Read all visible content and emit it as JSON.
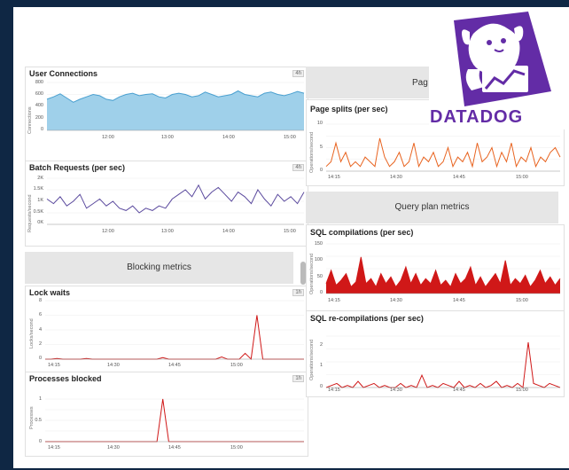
{
  "brand": {
    "name": "DATADOG"
  },
  "panels": {
    "user_connections": {
      "title": "User Connections",
      "badge": "4h",
      "ylabel": "Connections",
      "yticks": [
        "800",
        "600",
        "400",
        "200",
        "0"
      ],
      "xticks": [
        "12:00",
        "13:00",
        "14:00",
        "15:00"
      ]
    },
    "batch_requests": {
      "title": "Batch Requests (per sec)",
      "badge": "4h",
      "ylabel": "Requests/second",
      "yticks": [
        "2K",
        "1.5K",
        "1K",
        "0.5K",
        "0K"
      ],
      "xticks": [
        "12:00",
        "13:00",
        "14:00",
        "15:00"
      ]
    },
    "lock_waits": {
      "title": "Lock waits",
      "badge": "1h",
      "ylabel": "Locks/second",
      "yticks": [
        "8",
        "6",
        "4",
        "2",
        "0"
      ],
      "xticks": [
        "14:15",
        "14:30",
        "14:45",
        "15:00"
      ]
    },
    "processes_blocked": {
      "title": "Processes blocked",
      "badge": "1h",
      "ylabel": "Processes",
      "yticks": [
        "1",
        "0.5",
        "0"
      ],
      "xticks": [
        "14:15",
        "14:30",
        "14:45",
        "15:00"
      ]
    },
    "page_splits": {
      "title": "Page splits (per sec)",
      "ylabel": "Operations/second",
      "yticks": [
        "10",
        "5",
        "0"
      ],
      "xticks": [
        "14:15",
        "14:30",
        "14:45",
        "15:00"
      ]
    },
    "sql_compilations": {
      "title": "SQL compilations (per sec)",
      "ylabel": "Operations/second",
      "yticks": [
        "150",
        "100",
        "50",
        "0"
      ],
      "xticks": [
        "14:15",
        "14:30",
        "14:45",
        "15:00"
      ]
    },
    "sql_recompilations": {
      "title": "SQL re-compilations (per sec)",
      "ylabel": "Operations/second",
      "yticks": [
        "2",
        "1",
        "0"
      ],
      "xticks": [
        "14:15",
        "14:30",
        "14:45",
        "15:00"
      ]
    }
  },
  "sections": {
    "blocking": "Blocking metrics",
    "page": "Pag",
    "query_plan": "Query plan metrics"
  },
  "colors": {
    "blue_fill": "#9fd0ea",
    "blue_line": "#4aa0d0",
    "purple": "#5b4a9e",
    "orange": "#e8631f",
    "red": "#d01818",
    "brand": "#632ca6"
  },
  "chart_data": [
    {
      "type": "area",
      "title": "User Connections",
      "ylabel": "Connections",
      "ylim": [
        0,
        800
      ],
      "x": [
        "12:00",
        "13:00",
        "14:00",
        "15:00"
      ],
      "values": [
        520,
        560,
        610,
        540,
        470,
        520,
        560,
        600,
        580,
        520,
        500,
        560,
        600,
        620,
        580,
        600,
        610,
        560,
        540,
        600,
        620,
        600,
        560,
        580,
        640,
        600,
        560,
        580,
        600,
        660,
        600,
        580,
        560,
        620,
        640,
        600,
        580,
        610,
        650,
        620
      ]
    },
    {
      "type": "line",
      "title": "Batch Requests (per sec)",
      "ylabel": "Requests/second",
      "ylim": [
        0,
        2000
      ],
      "x": [
        "12:00",
        "13:00",
        "14:00",
        "15:00"
      ],
      "values": [
        1100,
        900,
        1200,
        800,
        1000,
        1300,
        700,
        900,
        1100,
        800,
        1000,
        700,
        600,
        800,
        500,
        700,
        600,
        800,
        700,
        1100,
        1300,
        1500,
        1200,
        1700,
        1100,
        1400,
        1600,
        1300,
        1000,
        1400,
        1200,
        900,
        1500,
        1100,
        800,
        1300,
        1000,
        1200,
        900,
        1400
      ]
    },
    {
      "type": "line",
      "title": "Lock waits",
      "ylabel": "Locks/second",
      "ylim": [
        0,
        8
      ],
      "x": [
        "14:15",
        "14:30",
        "14:45",
        "15:00"
      ],
      "values": [
        0,
        0,
        0.1,
        0,
        0,
        0,
        0,
        0.1,
        0,
        0,
        0,
        0,
        0,
        0,
        0,
        0,
        0,
        0,
        0,
        0,
        0.2,
        0,
        0,
        0,
        0,
        0,
        0,
        0,
        0,
        0,
        0.3,
        0,
        0,
        0,
        0.8,
        0,
        6,
        0,
        0,
        0,
        0,
        0,
        0,
        0,
        0
      ]
    },
    {
      "type": "line",
      "title": "Processes blocked",
      "ylabel": "Processes",
      "ylim": [
        0,
        1
      ],
      "x": [
        "14:15",
        "14:30",
        "14:45",
        "15:00"
      ],
      "values": [
        0,
        0,
        0,
        0,
        0,
        0,
        0,
        0,
        0,
        0,
        0,
        0,
        0,
        0,
        0,
        0,
        0,
        0,
        0,
        0,
        1,
        0,
        0,
        0,
        0,
        0,
        0,
        0,
        0,
        0,
        0,
        0,
        0,
        0,
        0,
        0,
        0,
        0,
        0,
        0,
        0,
        0,
        0,
        0,
        0
      ]
    },
    {
      "type": "line",
      "title": "Page splits (per sec)",
      "ylabel": "Operations/second",
      "ylim": [
        0,
        10
      ],
      "x": [
        "14:15",
        "14:30",
        "14:45",
        "15:00"
      ],
      "values": [
        1,
        2,
        6,
        2,
        4,
        1,
        2,
        1,
        3,
        2,
        1,
        7,
        3,
        1,
        2,
        4,
        1,
        2,
        6,
        1,
        3,
        2,
        4,
        1,
        2,
        5,
        1,
        3,
        2,
        4,
        1,
        6,
        2,
        3,
        5,
        1,
        4,
        2,
        6,
        1,
        3,
        2,
        5,
        1,
        3,
        2,
        4,
        5,
        3
      ]
    },
    {
      "type": "area",
      "title": "SQL compilations (per sec)",
      "ylabel": "Operations/second",
      "ylim": [
        0,
        150
      ],
      "x": [
        "14:15",
        "14:30",
        "14:45",
        "15:00"
      ],
      "values": [
        30,
        70,
        25,
        40,
        60,
        20,
        35,
        110,
        30,
        45,
        20,
        60,
        30,
        50,
        20,
        40,
        80,
        30,
        60,
        25,
        45,
        30,
        70,
        25,
        40,
        20,
        60,
        30,
        45,
        80,
        25,
        50,
        20,
        40,
        60,
        30,
        100,
        25,
        45,
        30,
        55,
        20,
        40,
        70,
        30,
        50,
        25,
        45
      ]
    },
    {
      "type": "line",
      "title": "SQL re-compilations (per sec)",
      "ylabel": "Operations/second",
      "ylim": [
        0,
        2.5
      ],
      "x": [
        "14:15",
        "14:30",
        "14:45",
        "15:00"
      ],
      "values": [
        0,
        0.1,
        0.2,
        0,
        0.1,
        0,
        0.3,
        0,
        0.1,
        0.2,
        0,
        0.1,
        0,
        0,
        0.2,
        0,
        0.1,
        0,
        0.6,
        0,
        0.1,
        0,
        0.2,
        0.1,
        0,
        0.3,
        0,
        0.1,
        0,
        0.2,
        0,
        0.1,
        0.3,
        0,
        0.1,
        0,
        0.2,
        0,
        2.2,
        0.2,
        0.1,
        0,
        0.2,
        0.1,
        0
      ]
    }
  ]
}
